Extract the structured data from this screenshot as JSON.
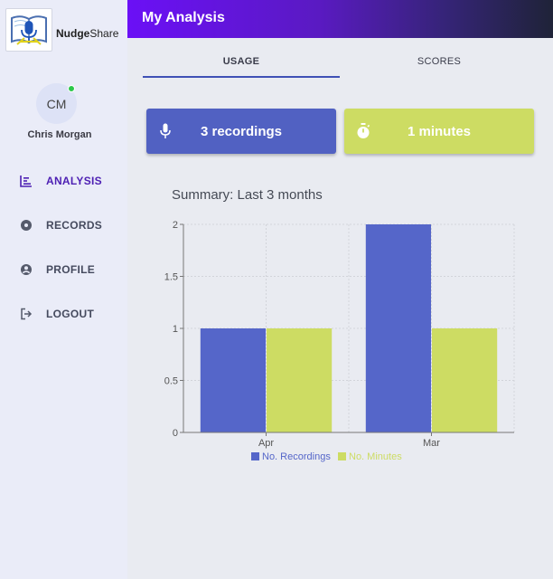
{
  "app": {
    "brand_bold": "Nudge",
    "brand_rest": "Share"
  },
  "header": {
    "title": "My Analysis"
  },
  "user": {
    "initials": "CM",
    "name": "Chris Morgan",
    "status_color": "#2cc84a"
  },
  "sidebar": {
    "items": [
      {
        "label": "ANALYSIS",
        "icon": "bar-chart-icon",
        "active": true
      },
      {
        "label": "RECORDS",
        "icon": "disc-icon",
        "active": false
      },
      {
        "label": "PROFILE",
        "icon": "account-icon",
        "active": false
      },
      {
        "label": "LOGOUT",
        "icon": "logout-icon",
        "active": false
      }
    ]
  },
  "tabs": [
    {
      "label": "USAGE",
      "active": true
    },
    {
      "label": "SCORES",
      "active": false
    }
  ],
  "stats": {
    "recordings": {
      "label": "3 recordings",
      "icon": "microphone-icon",
      "color": "#5161c2"
    },
    "minutes": {
      "label": "1 minutes",
      "icon": "timer-icon",
      "color": "#cddc63"
    }
  },
  "summary": {
    "title": "Summary: Last 3 months"
  },
  "colors": {
    "accent": "#6b10f6",
    "active_nav": "#4d1fb3",
    "tab_underline": "#3f51b5"
  },
  "chart_data": {
    "type": "bar",
    "categories": [
      "Apr",
      "Mar"
    ],
    "series": [
      {
        "name": "No. Recordings",
        "values": [
          1,
          2
        ],
        "color": "#5566c9"
      },
      {
        "name": "No. Minutes",
        "values": [
          1,
          1
        ],
        "color": "#cddc63"
      }
    ],
    "ylim": [
      0,
      2
    ],
    "yticks": [
      "0",
      "0.5",
      "1",
      "1.5",
      "2"
    ],
    "ytick_values": [
      0,
      0.5,
      1,
      1.5,
      2
    ],
    "grid": true,
    "legend": "bottom-center"
  }
}
